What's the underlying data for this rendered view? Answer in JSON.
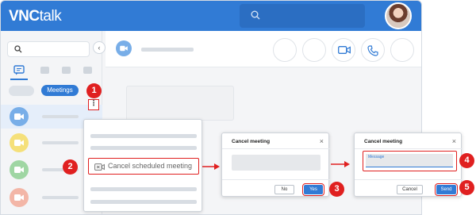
{
  "app": {
    "logo_bold": "VNC",
    "logo_light": "talk"
  },
  "sidebar": {
    "collapse_glyph": "‹",
    "filter_pill": "Meetings",
    "rows": [
      {
        "icon": "video-icon",
        "color": "#78aee8",
        "selected": true
      },
      {
        "icon": "video-icon",
        "color": "#f5e07a"
      },
      {
        "icon": "video-icon",
        "color": "#9fd6a3"
      },
      {
        "icon": "video-icon",
        "color": "#f3b6a7"
      }
    ],
    "more_glyph": "⋮"
  },
  "context_menu": {
    "item_label": "Cancel scheduled meeting",
    "item_icon": "video-cancel-icon"
  },
  "dialog_confirm": {
    "title": "Cancel meeting",
    "close": "×",
    "no_label": "No",
    "yes_label": "Yes"
  },
  "dialog_message": {
    "title": "Cancel meeting",
    "close": "×",
    "field_label": "Message",
    "cancel_label": "Cancel",
    "send_label": "Send"
  },
  "steps": [
    "1",
    "2",
    "3",
    "4",
    "5"
  ],
  "colors": {
    "brand": "#317bd5",
    "highlight": "#e02020"
  }
}
